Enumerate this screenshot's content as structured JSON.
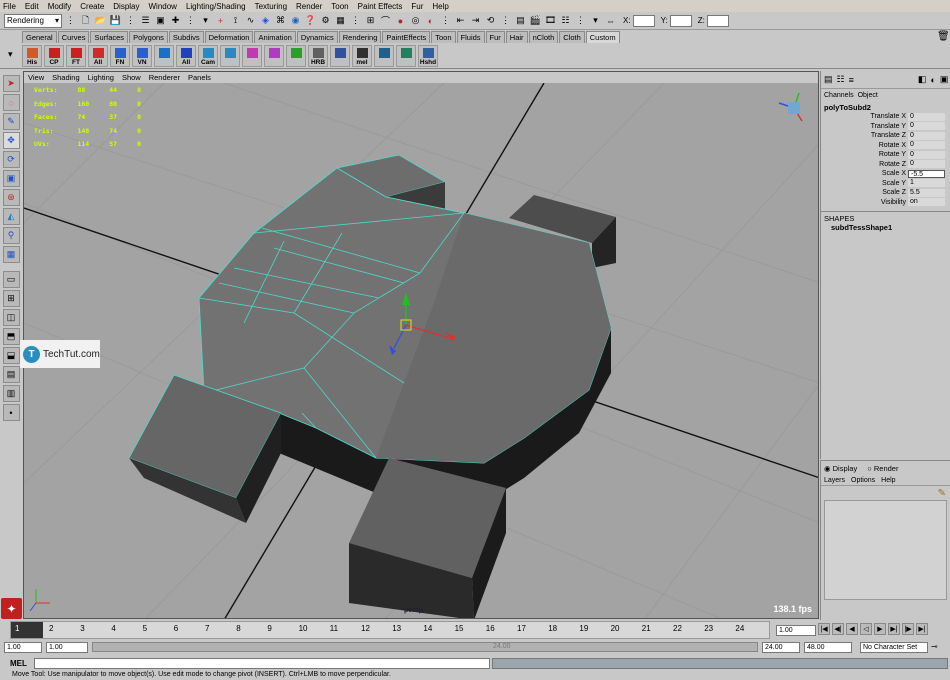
{
  "menu": [
    "File",
    "Edit",
    "Modify",
    "Create",
    "Display",
    "Window",
    "Lighting/Shading",
    "Texturing",
    "Render",
    "Toon",
    "Paint Effects",
    "Fur",
    "Help"
  ],
  "status": {
    "mode": "Rendering",
    "coord_x": "X:",
    "coord_y": "Y:",
    "coord_z": "Z:"
  },
  "shelf_tabs": [
    "General",
    "Curves",
    "Surfaces",
    "Polygons",
    "Subdivs",
    "Deformation",
    "Animation",
    "Dynamics",
    "Rendering",
    "PaintEffects",
    "Toon",
    "Fluids",
    "Fur",
    "Hair",
    "nCloth",
    "Cloth",
    "Custom"
  ],
  "shelf_active": "Custom",
  "shelf_buttons": [
    {
      "label": "His",
      "color": "#d05a2a"
    },
    {
      "label": "CP",
      "color": "#cc2020"
    },
    {
      "label": "FT",
      "color": "#cc2020"
    },
    {
      "label": "All",
      "color": "#d02a2a"
    },
    {
      "label": "FN",
      "color": "#2a5fd0"
    },
    {
      "label": "VN",
      "color": "#2a5fd0"
    },
    {
      "label": "",
      "color": "#1a70c8"
    },
    {
      "label": "All",
      "color": "#2040c0"
    },
    {
      "label": "Cam",
      "color": "#2a8ac0"
    },
    {
      "label": "",
      "color": "#2a8ac0"
    },
    {
      "label": "",
      "color": "#c03ab0"
    },
    {
      "label": "",
      "color": "#b03ac0"
    },
    {
      "label": "",
      "color": "#2aa02a"
    },
    {
      "label": "HRB",
      "color": "#606060"
    },
    {
      "label": "",
      "color": "#3050a0"
    },
    {
      "label": "mel",
      "color": "#303030"
    },
    {
      "label": "",
      "color": "#206090"
    },
    {
      "label": "",
      "color": "#208060"
    },
    {
      "label": "Hshd",
      "color": "#3060a0"
    }
  ],
  "panel_menu": [
    "View",
    "Shading",
    "Lighting",
    "Show",
    "Renderer",
    "Panels"
  ],
  "hud": [
    {
      "label": "Verts:",
      "a": "88",
      "b": "44",
      "c": "0"
    },
    {
      "label": "Edges:",
      "a": "160",
      "b": "80",
      "c": "0"
    },
    {
      "label": "Faces:",
      "a": "74",
      "b": "37",
      "c": "0"
    },
    {
      "label": "Tris:",
      "a": "148",
      "b": "74",
      "c": "0"
    },
    {
      "label": "UVs:",
      "a": "114",
      "b": "57",
      "c": "0"
    }
  ],
  "viewport": {
    "fps": "138.1 fps",
    "camera": "persp"
  },
  "watermark": {
    "text": "TechTut.com",
    "logo": "T"
  },
  "channel_box": {
    "menu": [
      "Channels",
      "Object"
    ],
    "node": "polyToSubd2",
    "attrs": [
      {
        "name": "Translate X",
        "value": "0"
      },
      {
        "name": "Translate Y",
        "value": "0"
      },
      {
        "name": "Translate Z",
        "value": "0"
      },
      {
        "name": "Rotate X",
        "value": "0"
      },
      {
        "name": "Rotate Y",
        "value": "0"
      },
      {
        "name": "Rotate Z",
        "value": "0"
      },
      {
        "name": "Scale X",
        "value": "-5.5"
      },
      {
        "name": "Scale Y",
        "value": "1"
      },
      {
        "name": "Scale Z",
        "value": "5.5"
      },
      {
        "name": "Visibility",
        "value": "on"
      }
    ],
    "shapes_header": "SHAPES",
    "shape": "subdTessShape1"
  },
  "layer_editor": {
    "display": "Display",
    "render": "Render",
    "menu": [
      "Layers",
      "Options",
      "Help"
    ]
  },
  "timeline": {
    "ticks": [
      "1",
      "2",
      "3",
      "4",
      "5",
      "6",
      "7",
      "8",
      "9",
      "10",
      "11",
      "12",
      "13",
      "14",
      "15",
      "16",
      "17",
      "18",
      "19",
      "20",
      "21",
      "22",
      "23",
      "24"
    ],
    "current": "1",
    "current_field": "1.00"
  },
  "range": {
    "start": "1.00",
    "start2": "1.00",
    "center": "24.00",
    "end": "24.00",
    "end2": "48.00",
    "character": "No Character Set"
  },
  "cmd": {
    "label": "MEL"
  },
  "help": "Move Tool: Use manipulator to move object(s). Use edit mode to change pivot (INSERT). Ctrl+LMB to move perpendicular."
}
